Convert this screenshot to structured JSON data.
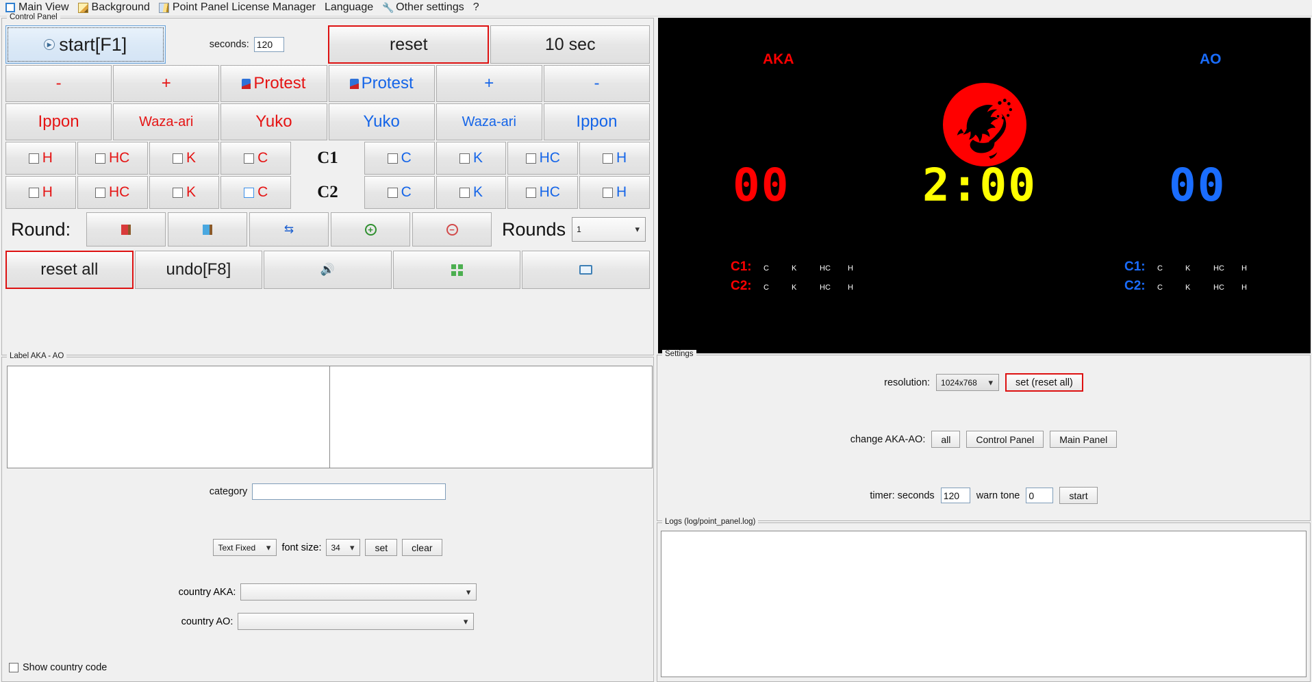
{
  "menu": {
    "items": [
      {
        "label": "Main View",
        "icon": "checkbox-icon"
      },
      {
        "label": "Background",
        "icon": "pencil-icon"
      },
      {
        "label": "Point Panel License Manager",
        "icon": "book-icon"
      },
      {
        "label": "Language",
        "icon": "none"
      },
      {
        "label": "Other settings",
        "icon": "wrench-icon"
      },
      {
        "label": "?",
        "icon": "none"
      }
    ]
  },
  "control_panel": {
    "title": "Control Panel",
    "start_button": "start[F1]",
    "seconds_label": "seconds:",
    "seconds_value": "120",
    "reset_button": "reset",
    "tensec_button": "10 sec",
    "adjust_row": [
      {
        "label": "-",
        "color": "#e51414"
      },
      {
        "label": "+",
        "color": "#e51414"
      },
      {
        "label": "Protest",
        "color": "#e51414",
        "icon": "protest-flag-icon"
      },
      {
        "label": "Protest",
        "color": "#1565e8",
        "icon": "protest-flag-icon"
      },
      {
        "label": "+",
        "color": "#1565e8"
      },
      {
        "label": "-",
        "color": "#1565e8"
      }
    ],
    "score_row": [
      {
        "label": "Ippon",
        "color": "#e51414",
        "size": "big"
      },
      {
        "label": "Waza-ari",
        "color": "#e51414",
        "size": "small"
      },
      {
        "label": "Yuko",
        "color": "#e51414",
        "size": "big"
      },
      {
        "label": "Yuko",
        "color": "#1565e8",
        "size": "big"
      },
      {
        "label": "Waza-ari",
        "color": "#1565e8",
        "size": "small"
      },
      {
        "label": "Ippon",
        "color": "#1565e8",
        "size": "big"
      }
    ],
    "c1_row": {
      "index": "C1",
      "left": [
        {
          "label": "H",
          "color": "#e51414",
          "selected": false
        },
        {
          "label": "HC",
          "color": "#e51414",
          "selected": false
        },
        {
          "label": "K",
          "color": "#e51414",
          "selected": false
        },
        {
          "label": "C",
          "color": "#e51414",
          "selected": false
        }
      ],
      "right": [
        {
          "label": "C",
          "color": "#1565e8",
          "selected": false
        },
        {
          "label": "K",
          "color": "#1565e8",
          "selected": false
        },
        {
          "label": "HC",
          "color": "#1565e8",
          "selected": false
        },
        {
          "label": "H",
          "color": "#1565e8",
          "selected": false
        }
      ]
    },
    "c2_row": {
      "index": "C2",
      "left": [
        {
          "label": "H",
          "color": "#e51414",
          "selected": false
        },
        {
          "label": "HC",
          "color": "#e51414",
          "selected": false
        },
        {
          "label": "K",
          "color": "#e51414",
          "selected": false
        },
        {
          "label": "C",
          "color": "#e51414",
          "selected": true
        }
      ],
      "right": [
        {
          "label": "C",
          "color": "#1565e8",
          "selected": false
        },
        {
          "label": "K",
          "color": "#1565e8",
          "selected": false
        },
        {
          "label": "HC",
          "color": "#1565e8",
          "selected": false
        },
        {
          "label": "H",
          "color": "#1565e8",
          "selected": false
        }
      ]
    },
    "round_label": "Round:",
    "round_buttons": [
      {
        "icon": "red-flag-icon"
      },
      {
        "icon": "blue-flag-icon"
      },
      {
        "icon": "swap-icon"
      },
      {
        "icon": "plus-circle-icon"
      },
      {
        "icon": "minus-circle-icon"
      }
    ],
    "rounds_label": "Rounds",
    "rounds_value": "1",
    "bottom_buttons": [
      {
        "label": "reset all",
        "highlight": true
      },
      {
        "label": "undo[F8]",
        "highlight": false
      },
      {
        "label": "",
        "icon": "speaker-icon",
        "highlight": false
      },
      {
        "label": "",
        "icon": "grid-icon",
        "highlight": false
      },
      {
        "label": "",
        "icon": "monitor-icon",
        "highlight": false
      }
    ]
  },
  "label_panel": {
    "title": "Label AKA - AO",
    "aka_name": "",
    "ao_name": "",
    "category_label": "category",
    "category_value": "",
    "text_mode": "Text Fixed",
    "fontsize_label": "font size:",
    "fontsize_value": "34",
    "set_button": "set",
    "clear_button": "clear",
    "country_aka_label": "country AKA:",
    "country_aka_value": "",
    "country_ao_label": "country AO:",
    "country_ao_value": "",
    "show_country_code": "Show country code"
  },
  "display": {
    "aka_label": "AKA",
    "ao_label": "AO",
    "aka_score": "00",
    "ao_score": "00",
    "timer": "2:00",
    "logo": "tiger-emblem",
    "aka_color": "#ff0000",
    "ao_color": "#1a6dff",
    "timer_color": "#ffff00",
    "aka_penalties": [
      {
        "tag": "C1:",
        "items": [
          "C",
          "K",
          "HC",
          "H"
        ]
      },
      {
        "tag": "C2:",
        "items": [
          "C",
          "K",
          "HC",
          "H"
        ]
      }
    ],
    "ao_penalties": [
      {
        "tag": "C1:",
        "items": [
          "C",
          "K",
          "HC",
          "H"
        ]
      },
      {
        "tag": "C2:",
        "items": [
          "C",
          "K",
          "HC",
          "H"
        ]
      }
    ]
  },
  "settings": {
    "title": "Settings",
    "resolution_label": "resolution:",
    "resolution_value": "1024x768",
    "set_reset_button": "set (reset all)",
    "change_label": "change  AKA-AO:",
    "change_buttons": [
      "all",
      "Control Panel",
      "Main Panel"
    ],
    "timer_label": "timer: seconds",
    "timer_value": "120",
    "warn_label": "warn tone",
    "warn_value": "0",
    "start_button": "start"
  },
  "logs": {
    "title": "Logs (log/point_panel.log)",
    "content": ""
  }
}
